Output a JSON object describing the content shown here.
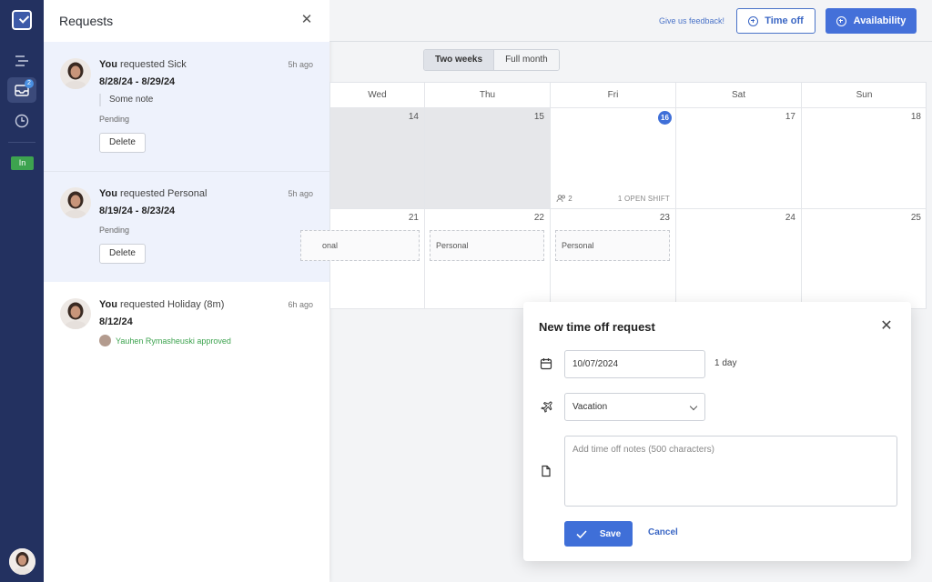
{
  "panel": {
    "title": "Requests",
    "requests": [
      {
        "who": "You",
        "text": "requested Sick",
        "ago": "5h ago",
        "dates": "8/28/24 - 8/29/24",
        "note": "Some note",
        "status": "Pending",
        "action": "Delete"
      },
      {
        "who": "You",
        "text": "requested Personal",
        "ago": "5h ago",
        "dates": "8/19/24 - 8/23/24",
        "status": "Pending",
        "action": "Delete"
      },
      {
        "who": "You",
        "text": "requested Holiday (8m)",
        "ago": "6h ago",
        "dates": "8/12/24",
        "approver": "Yauhen Rymasheuski approved"
      }
    ]
  },
  "rail": {
    "inbox_badge": "2",
    "status_pill": "In"
  },
  "topbar": {
    "feedback": "Give us feedback!",
    "time_off": "Time off",
    "availability": "Availability"
  },
  "view_toggle": {
    "active": "Two weeks",
    "other": "Full month"
  },
  "calendar": {
    "days": [
      "Wed",
      "Thu",
      "Fri",
      "Sat",
      "Sun"
    ],
    "week1": [
      "14",
      "15",
      "16",
      "17",
      "18"
    ],
    "week2": [
      "21",
      "22",
      "23",
      "24",
      "25"
    ],
    "shift_count": "2",
    "open_shift": "1 OPEN SHIFT",
    "chip_partial": "onal",
    "chip": "Personal"
  },
  "modal": {
    "title": "New time off request",
    "date": "10/07/2024",
    "duration": "1 day",
    "type": "Vacation",
    "notes_placeholder": "Add time off notes (500 characters)",
    "save": "Save",
    "cancel": "Cancel"
  },
  "colors": {
    "rail": "#233160",
    "accent": "#4470d9",
    "approved": "#3da34f",
    "highlight": "#eef2fc"
  }
}
